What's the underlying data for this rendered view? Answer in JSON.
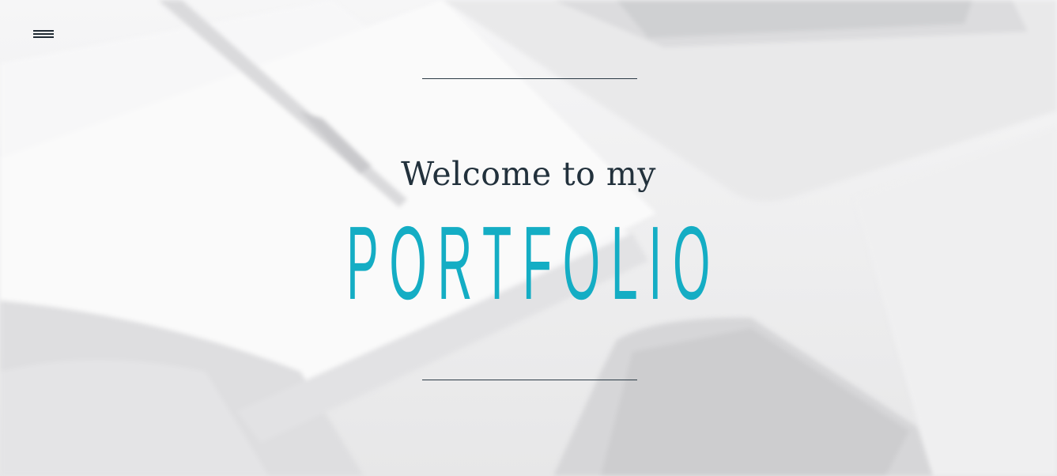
{
  "nav": {
    "menu_icon": "hamburger-menu-icon"
  },
  "hero": {
    "greeting": "Welcome to my",
    "title": "PORTFOLIO"
  },
  "colors": {
    "accent": "#14adc4",
    "text": "#22313c",
    "rule": "#2b3a45"
  }
}
